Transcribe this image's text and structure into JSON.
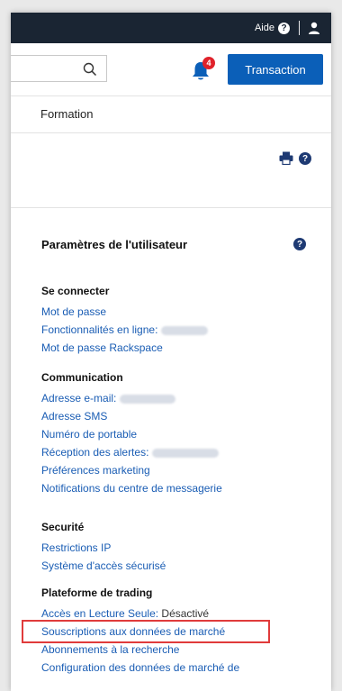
{
  "topbar": {
    "help_label": "Aide",
    "help_icon": "?"
  },
  "header": {
    "notification_count": "4",
    "transaction_button": "Transaction"
  },
  "nav": {
    "formation": "Formation"
  },
  "tools": {
    "help_icon": "?"
  },
  "settings": {
    "title": "Paramètres de l'utilisateur",
    "help_icon": "?",
    "groups": [
      {
        "heading": "Se connecter",
        "items": [
          "Mot de passe",
          "Fonctionnalités en ligne:",
          "Mot de passe Rackspace"
        ]
      },
      {
        "heading": "Communication",
        "items": [
          "Adresse e-mail:",
          "Adresse SMS",
          "Numéro de portable",
          "Réception des alertes:",
          "Préférences marketing",
          "Notifications du centre de messagerie"
        ]
      },
      {
        "heading": "Securité",
        "items": [
          "Restrictions IP",
          "Système d'accès sécurisé"
        ]
      },
      {
        "heading": "Plateforme de trading",
        "items": [
          "Accès en Lecture Seule:",
          "Souscriptions aux données de marché",
          "Abonnements à la recherche",
          "Configuration des données de marché de"
        ],
        "read_only_value": "Désactivé"
      }
    ]
  },
  "colors": {
    "topbar": "#1a2533",
    "accent": "#0b5fb8",
    "link": "#1a5db4",
    "badge": "#e0222b",
    "highlight": "#e03b3b"
  }
}
